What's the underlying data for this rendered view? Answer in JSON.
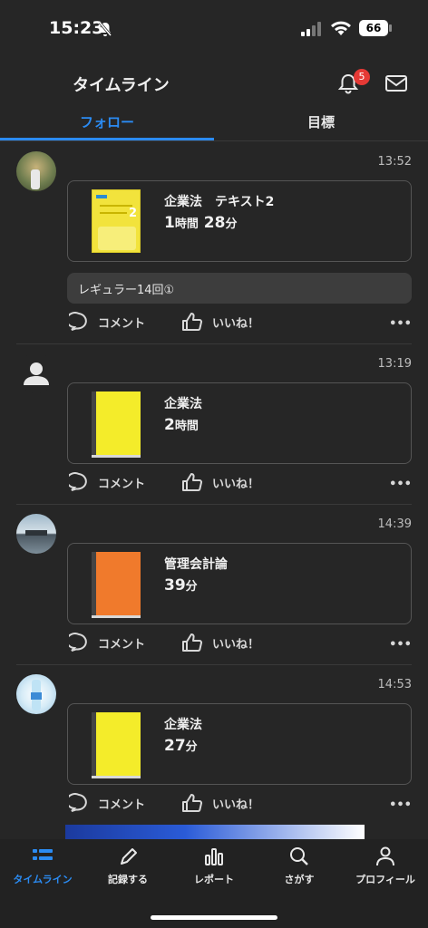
{
  "status": {
    "time": "15:23",
    "battery": "66"
  },
  "header": {
    "title": "タイムライン",
    "notification_count": "5"
  },
  "tabs": [
    {
      "label": "フォロー",
      "active": true
    },
    {
      "label": "目標",
      "active": false
    }
  ],
  "posts": [
    {
      "time": "13:52",
      "subject": "企業法　テキスト2",
      "duration_num1": "1",
      "duration_unit1": "時間",
      "duration_num2": "28",
      "duration_unit2": "分",
      "note": "レギュラー14回①",
      "book_color": "#f2e33c"
    },
    {
      "time": "13:19",
      "subject": "企業法",
      "duration_num1": "2",
      "duration_unit1": "時間",
      "book_color": "#f4ec2a"
    },
    {
      "time": "14:39",
      "subject": "管理会計論",
      "duration_num1": "39",
      "duration_unit1": "分",
      "book_color": "#f07a2c"
    },
    {
      "time": "14:53",
      "subject": "企業法",
      "duration_num1": "27",
      "duration_unit1": "分",
      "book_color": "#f4ec2a"
    }
  ],
  "actions": {
    "comment": "コメント",
    "like": "いいね！",
    "more": "•••"
  },
  "nav": [
    {
      "label": "タイムライン",
      "active": true
    },
    {
      "label": "記録する"
    },
    {
      "label": "レポート"
    },
    {
      "label": "さがす"
    },
    {
      "label": "プロフィール"
    }
  ],
  "colors": {
    "accent": "#2b8bf2",
    "background": "#262626",
    "badge": "#e53935"
  }
}
